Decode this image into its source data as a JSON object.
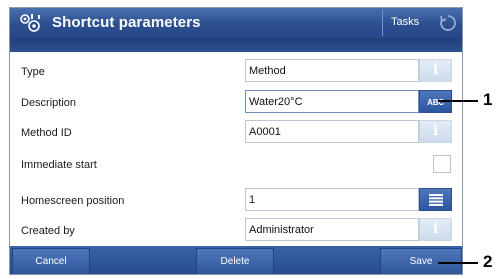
{
  "title_bar": {
    "title": "Shortcut parameters",
    "tasks_label": "Tasks"
  },
  "fields": [
    {
      "label": "Type",
      "value": "Method",
      "button": "info-icon",
      "button_glyph": "i"
    },
    {
      "label": "Description",
      "value": "Water20°C",
      "button": "keyboard-abc-icon",
      "button_glyph": "ABC"
    },
    {
      "label": "Method ID",
      "value": "A0001",
      "button": "info-icon",
      "button_glyph": "i"
    },
    {
      "label": "Immediate start",
      "checked": false
    },
    {
      "label": "Homescreen position",
      "value": "1",
      "button": "list-icon"
    },
    {
      "label": "Created by",
      "value": "Administrator",
      "button": "info-icon",
      "button_glyph": "i"
    }
  ],
  "bottom_bar": {
    "cancel_label": "Cancel",
    "delete_label": "Delete",
    "save_label": "Save"
  },
  "callouts": {
    "one": "1",
    "two": "2"
  },
  "colors": {
    "title_bar": "#2b4f8f",
    "accent_button": "#2b559e",
    "info_button": "#d6e2ef"
  }
}
